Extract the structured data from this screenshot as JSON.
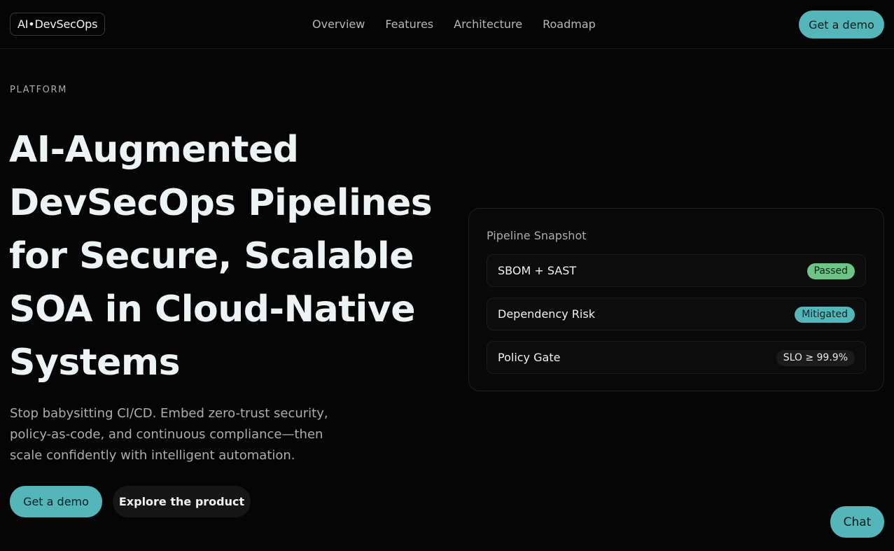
{
  "brand": {
    "logo": "AI•DevSecOps"
  },
  "nav": {
    "items": [
      {
        "label": "Overview"
      },
      {
        "label": "Features"
      },
      {
        "label": "Architecture"
      },
      {
        "label": "Roadmap"
      }
    ],
    "cta_label": "Get a demo"
  },
  "hero": {
    "kicker": "PLATFORM",
    "title": "AI-Augmented DevSecOps Pipelines for Secure, Scalable SOA in Cloud-Native Systems",
    "lede": "Stop babysitting CI/CD. Embed zero-trust security, policy-as-code, and continuous compliance—then scale confidently with intelligent automation.",
    "primary_cta": "Get a demo",
    "secondary_cta": "Explore the product"
  },
  "snapshot": {
    "title": "Pipeline Snapshot",
    "rows": [
      {
        "label": "SBOM + SAST",
        "status": "Passed"
      },
      {
        "label": "Dependency Risk",
        "status": "Mitigated"
      },
      {
        "label": "Policy Gate",
        "status": "SLO ≥ 99.9%"
      }
    ]
  },
  "chat": {
    "label": "Chat"
  },
  "colors": {
    "accent": "#54b6b8",
    "success": "#6cc487",
    "background": "#050505"
  }
}
